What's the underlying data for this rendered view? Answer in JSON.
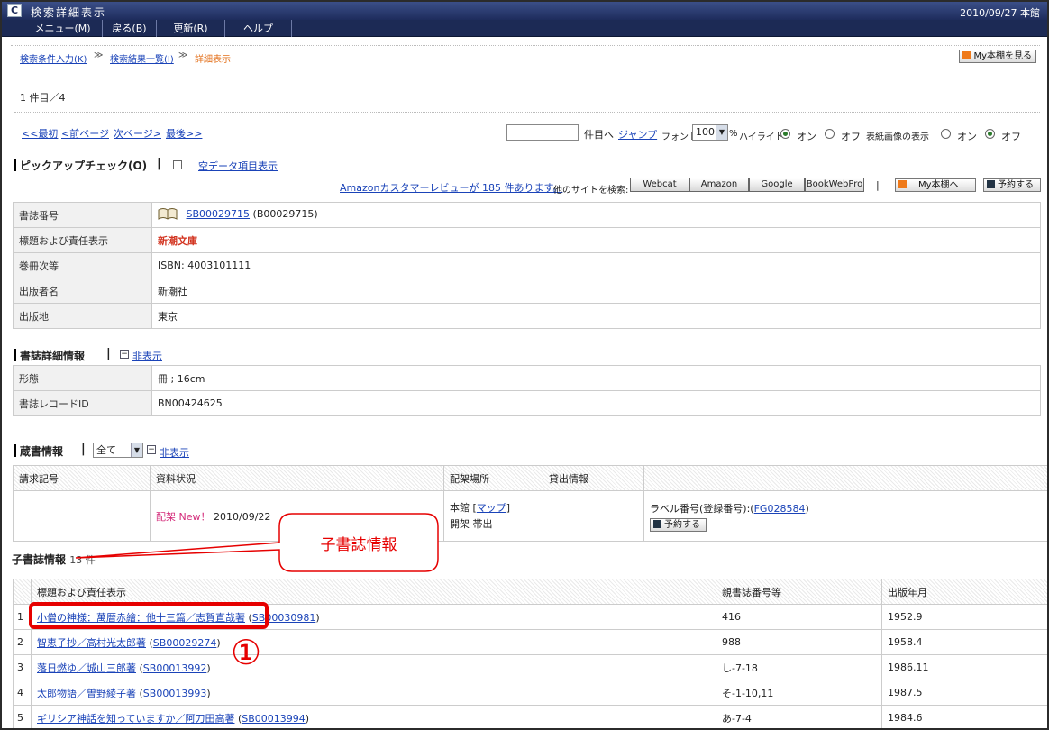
{
  "window": {
    "title": "検索詳細表示",
    "datetime": "2010/09/27 本館",
    "app_icon": "C"
  },
  "menubar": [
    "メニュー(M)",
    "戻る(B)",
    "更新(R)",
    "ヘルプ"
  ],
  "breadcrumb": {
    "step1": "検索条件入力(K)",
    "sep": "≫",
    "step2": "検索結果一覧(I)",
    "current": "詳細表示",
    "my_shelf_btn": "My本棚を見る"
  },
  "result_count": "1 件目／4",
  "pager": {
    "first": "<<最初",
    "prev": "<前ページ",
    "next": "次ページ>",
    "last": "最後>>"
  },
  "jump": {
    "suffix": "件目へ",
    "link": "ジャンプ"
  },
  "font": {
    "label": "フォント",
    "size": "100",
    "unit": "%"
  },
  "highlight": {
    "label": "ハイライト",
    "on": "オン",
    "off": "オフ"
  },
  "cover": {
    "label": "表紙画像の表示",
    "on": "オン",
    "off": "オフ"
  },
  "pickup": {
    "title": "ピックアップチェック(O)",
    "bar": "|",
    "empty_fields": "空データ項目表示"
  },
  "amazon_review": "Amazonカスタマーレビューが 185 件あります。",
  "other_sites": {
    "label": "他のサイトを検索:",
    "buttons": [
      "Webcat",
      "Amazon",
      "Google",
      "BookWebPro"
    ],
    "pipe": "|",
    "my_shelf": "My本棚へ",
    "reserve": "予約する"
  },
  "biblio": {
    "rows": [
      {
        "label": "書誌番号",
        "link": "SB00029715",
        "value": "(B00029715)"
      },
      {
        "label": "標題および責任表示",
        "value": "新潮文庫"
      },
      {
        "label": "巻冊次等",
        "value": "ISBN: 4003101111"
      },
      {
        "label": "出版者名",
        "value": "新潮社"
      },
      {
        "label": "出版地",
        "value": "東京"
      }
    ]
  },
  "detail": {
    "title": "書誌詳細情報",
    "hide": "非表示",
    "rows": [
      {
        "label": "形態",
        "value": "冊 ; 16cm"
      },
      {
        "label": "書誌レコードID",
        "value": "BN00424625"
      }
    ]
  },
  "holdings": {
    "title": "蔵書情報",
    "filter": "全て",
    "hide": "非表示",
    "headers": [
      "請求記号",
      "資料状況",
      "配架場所",
      "貸出情報",
      ""
    ],
    "row": {
      "status": "配架",
      "new": "New！",
      "date": "2010/09/22",
      "location": "本館",
      "map": "マップ",
      "location2": "開架 帯出",
      "label_no": "ラベル番号(登録番号):",
      "label_link": "FG028584",
      "reserve": "予約する"
    }
  },
  "child": {
    "title": "子書誌情報",
    "count": "13 件",
    "headers": [
      "",
      "標題および責任表示",
      "親書誌番号等",
      "出版年月"
    ],
    "rows": [
      {
        "n": "1",
        "title": "小僧の神様：萬暦赤繪：他十三篇／志賀直哉著",
        "id": "SB00030981",
        "vol": "416",
        "date": "1952.9"
      },
      {
        "n": "2",
        "title": "智恵子抄／高村光太郎著",
        "id": "SB00029274",
        "vol": "988",
        "date": "1958.4"
      },
      {
        "n": "3",
        "title": "落日燃ゆ／城山三郎著",
        "id": "SB00013992",
        "vol": "し-7-18",
        "date": "1986.11"
      },
      {
        "n": "4",
        "title": "太郎物語／曽野綾子著",
        "id": "SB00013993",
        "vol": "そ-1-10,11",
        "date": "1987.5"
      },
      {
        "n": "5",
        "title": "ギリシア神話を知っていますか／阿刀田高著",
        "id": "SB00013994",
        "vol": "あ-7-4",
        "date": "1984.6"
      }
    ]
  },
  "annotation": {
    "callout": "子書誌情報",
    "marker": "①"
  }
}
